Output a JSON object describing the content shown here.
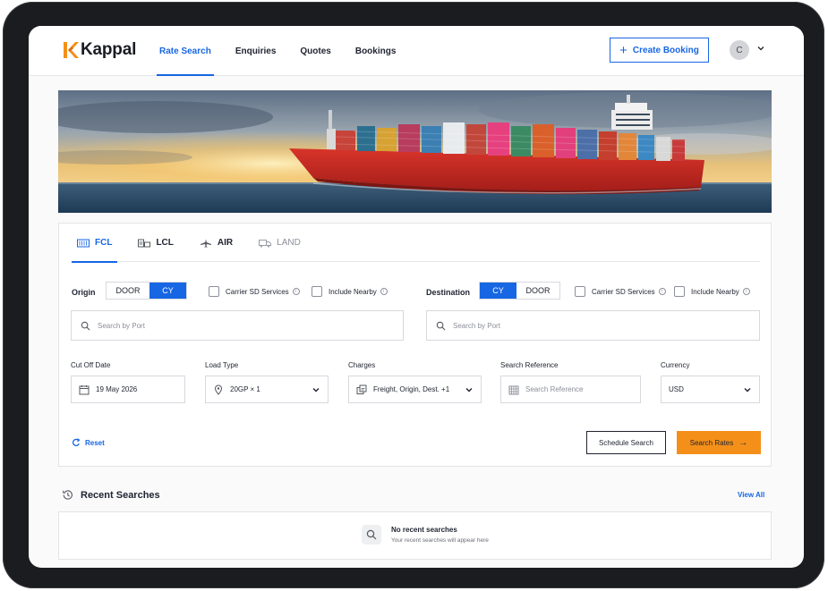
{
  "app": {
    "name": "Kappal",
    "brand_color": "#f4901a",
    "accent": "#1766e3"
  },
  "nav": {
    "items": [
      {
        "label": "Rate Search",
        "active": true
      },
      {
        "label": "Enquiries",
        "active": false
      },
      {
        "label": "Quotes",
        "active": false
      },
      {
        "label": "Bookings",
        "active": false
      }
    ],
    "create_booking": "Create Booking",
    "avatar_initial": "C"
  },
  "search": {
    "tabs": [
      {
        "label": "FCL",
        "icon": "container-icon",
        "state": "active"
      },
      {
        "label": "LCL",
        "icon": "warehouse-icon",
        "state": "normal"
      },
      {
        "label": "AIR",
        "icon": "airplane-icon",
        "state": "normal"
      },
      {
        "label": "LAND",
        "icon": "truck-icon",
        "state": "disabled"
      }
    ],
    "origin": {
      "label": "Origin",
      "options": [
        "DOOR",
        "CY"
      ],
      "selected": "CY",
      "carrier_sd": "Carrier SD Services",
      "include_nearby": "Include Nearby",
      "placeholder": "Search by Port"
    },
    "destination": {
      "label": "Destination",
      "options": [
        "CY",
        "DOOR"
      ],
      "selected": "CY",
      "carrier_sd": "Carrier SD Services",
      "include_nearby": "Include Nearby",
      "placeholder": "Search by Port"
    },
    "cutoff": {
      "label": "Cut Off Date",
      "value": "19 May 2026"
    },
    "load_type": {
      "label": "Load Type",
      "value": "20GP × 1"
    },
    "charges": {
      "label": "Charges",
      "value": "Freight, Origin, Dest. +1"
    },
    "reference": {
      "label": "Search Reference",
      "placeholder": "Search Reference"
    },
    "currency": {
      "label": "Currency",
      "value": "USD"
    },
    "reset": "Reset",
    "schedule_search": "Schedule Search",
    "search_rates": "Search Rates"
  },
  "recent": {
    "title": "Recent Searches",
    "view_all": "View All",
    "empty_title": "No recent searches",
    "empty_sub": "Your recent searches will appear here"
  }
}
